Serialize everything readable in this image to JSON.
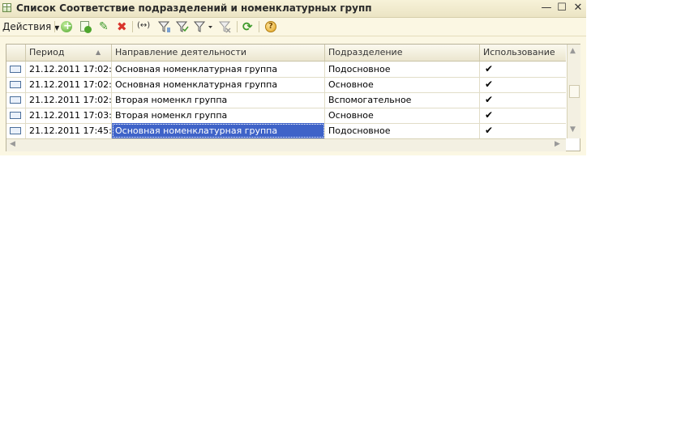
{
  "window": {
    "title": "Список Соответствие подразделений и номенклатурных групп",
    "minimize_glyph": "—",
    "maximize_glyph": "☐",
    "close_glyph": "✕"
  },
  "toolbar": {
    "actions_label": "Действия",
    "icons": [
      "add-icon",
      "copy-icon",
      "edit-icon",
      "delete-icon",
      "interval-icon",
      "filter-icon",
      "filter-set-icon",
      "filter-menu-icon",
      "filter-clear-icon",
      "refresh-icon",
      "help-icon"
    ],
    "help_glyph": "?",
    "interval_glyph": "(↔)",
    "refresh_glyph": "⟳"
  },
  "table": {
    "columns": [
      "Период",
      "Направление деятельности",
      "Подразделение",
      "Использование"
    ],
    "sort_glyph": "▲",
    "rows": [
      {
        "period": "21.12.2011 17:02:...",
        "direction": "Основная номенклатурная группа",
        "division": "Подосновное",
        "used": "✔"
      },
      {
        "period": "21.12.2011 17:02:...",
        "direction": "Основная номенклатурная группа",
        "division": "Основное",
        "used": "✔"
      },
      {
        "period": "21.12.2011 17:02:...",
        "direction": "Вторая номенкл группа",
        "division": "Вспомогательное",
        "used": "✔"
      },
      {
        "period": "21.12.2011 17:03:...",
        "direction": "Вторая номенкл группа",
        "division": "Основное",
        "used": "✔"
      },
      {
        "period": "21.12.2011 17:45:...",
        "direction": "Основная номенклатурная группа",
        "division": "Подосновное",
        "used": "✔"
      }
    ],
    "selected_row": 4
  },
  "colors": {
    "selection": "#3f63c8",
    "panel": "#fbf7e3"
  }
}
